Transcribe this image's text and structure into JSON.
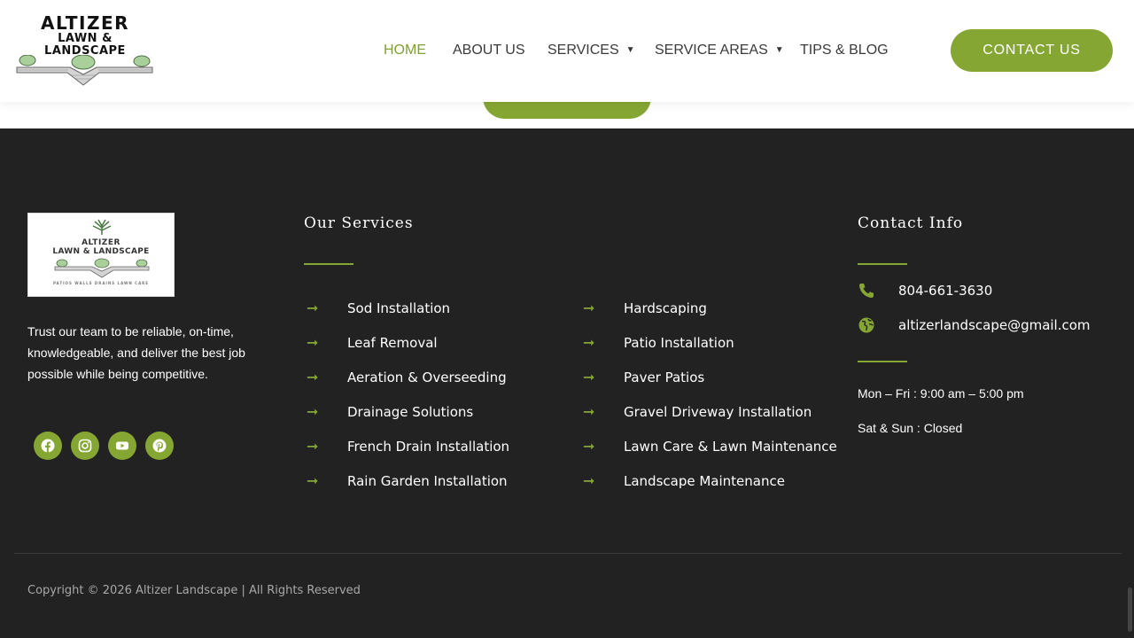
{
  "header": {
    "logo": {
      "line1": "ALTIZER",
      "line2": "LAWN &",
      "line3": "LANDSCAPE"
    },
    "nav": [
      {
        "label": "HOME",
        "active": true,
        "dropdown": false
      },
      {
        "label": "ABOUT US",
        "active": false,
        "dropdown": false
      },
      {
        "label": "SERVICES",
        "active": false,
        "dropdown": true
      },
      {
        "label": "SERVICE AREAS",
        "active": false,
        "dropdown": true
      },
      {
        "label": "TIPS & BLOG",
        "active": false,
        "dropdown": false
      }
    ],
    "contact_label": "CONTACT US"
  },
  "footer": {
    "brand_card": {
      "line1": "ALTIZER",
      "line2": "LAWN & LANDSCAPE",
      "tagline": "PATIOS  WALLS  DRAINS  LAWN CARE"
    },
    "about": "Trust our team to be reliable, on-time, knowledgeable, and deliver the best job possible while being competitive.",
    "socials": [
      "facebook-icon",
      "instagram-icon",
      "youtube-icon",
      "pinterest-icon"
    ],
    "services_title": "Our Services",
    "services_left": [
      "Sod Installation",
      "Leaf Removal",
      "Aeration & Overseeding",
      "Drainage Solutions",
      "French Drain Installation",
      "Rain Garden Installation"
    ],
    "services_right": [
      "Hardscaping",
      "Patio Installation",
      "Paver Patios",
      "Gravel Driveway Installation",
      "Lawn Care & Lawn Maintenance",
      "Landscape Maintenance"
    ],
    "contact_title": "Contact Info",
    "phone": "804-661-3630",
    "email": "altizerlandscape@gmail.com",
    "hours_weekday": "Mon – Fri : 9:00 am – 5:00 pm",
    "hours_weekend": "Sat & Sun : Closed",
    "copyright": "Copyright © 2026 Altizer Landscape | All Rights Reserved"
  },
  "colors": {
    "accent": "#86a633",
    "dark_bg": "#222222",
    "nav_text": "#3a3a3a"
  }
}
